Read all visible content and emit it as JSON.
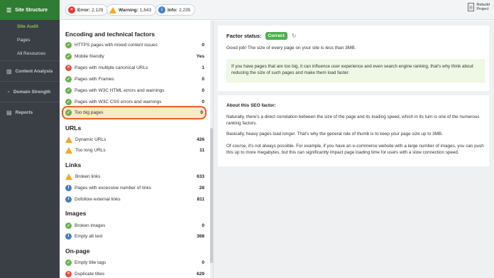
{
  "sidebar": {
    "title": "Site Structure",
    "subitems": [
      "Site Audit",
      "Pages",
      "All Resources"
    ],
    "sections": [
      "Content Analysis",
      "Domain Strength",
      "Reports"
    ]
  },
  "topbar": {
    "error_label": "Error:",
    "error_count": "2,129",
    "warning_label": "Warning:",
    "warning_count": "1,643",
    "info_label": "Info:",
    "info_count": "2,235",
    "rebuild_line1": "Rebuild",
    "rebuild_line2": "Project"
  },
  "categories": [
    {
      "title": "Encoding and technical factors",
      "rows": [
        {
          "status": "ok",
          "label": "HTTPS pages with mixed content issues",
          "value": "0"
        },
        {
          "status": "ok",
          "label": "Mobile friendly",
          "value": "Yes"
        },
        {
          "status": "err",
          "label": "Pages with multiple canonical URLs",
          "value": "1"
        },
        {
          "status": "ok",
          "label": "Pages with Frames",
          "value": "0"
        },
        {
          "status": "ok",
          "label": "Pages with W3C HTML errors and warnings",
          "value": "0"
        },
        {
          "status": "ok",
          "label": "Pages with W3C CSS errors and warnings",
          "value": "0"
        },
        {
          "status": "ok",
          "label": "Too big pages",
          "value": "0"
        }
      ]
    },
    {
      "title": "URLs",
      "rows": [
        {
          "status": "warn",
          "label": "Dynamic URLs",
          "value": "426"
        },
        {
          "status": "warn",
          "label": "Too long URLs",
          "value": "11"
        }
      ]
    },
    {
      "title": "Links",
      "rows": [
        {
          "status": "warn",
          "label": "Broken links",
          "value": "633"
        },
        {
          "status": "info",
          "label": "Pages with excessive number of links",
          "value": "28"
        },
        {
          "status": "info",
          "label": "Dofollow external links",
          "value": "811"
        }
      ]
    },
    {
      "title": "Images",
      "rows": [
        {
          "status": "ok",
          "label": "Broken images",
          "value": "0"
        },
        {
          "status": "info",
          "label": "Empty alt text",
          "value": "368"
        }
      ]
    },
    {
      "title": "On-page",
      "rows": [
        {
          "status": "ok",
          "label": "Empty title tags",
          "value": "0"
        },
        {
          "status": "err",
          "label": "Duplicate titles",
          "value": "629"
        }
      ]
    }
  ],
  "factor": {
    "status_label": "Factor status:",
    "status_badge": "Correct",
    "message": "Good job! The size of every page on your site is less than 3MB.",
    "tip": "If you have pages that are too big, it can influence user experience and even search engine ranking, that's why think about reducing the size of such pages and make them load faster."
  },
  "about": {
    "heading": "About this SEO factor:",
    "p1": "Naturally, there's a direct correlation between the size of the page and its loading speed, which in its turn is one of the numerous ranking factors.",
    "p2": "Basically, heavy pages load longer. That's why the general rule of thumb is to keep your page size up to 3MB.",
    "p3": "Of course, it's not always possible. For example, if you have an e-commerce website with a large number of images, you can push this up to more megabytes, but this can significantly impact page loading time for users with a slow connection speed."
  },
  "colors": {
    "accent": "#2e7d32",
    "ok": "#6ab04c",
    "error": "#e74c3c",
    "warning": "#f5a623",
    "info": "#4a7fc1",
    "highlight": "#e8602c"
  }
}
